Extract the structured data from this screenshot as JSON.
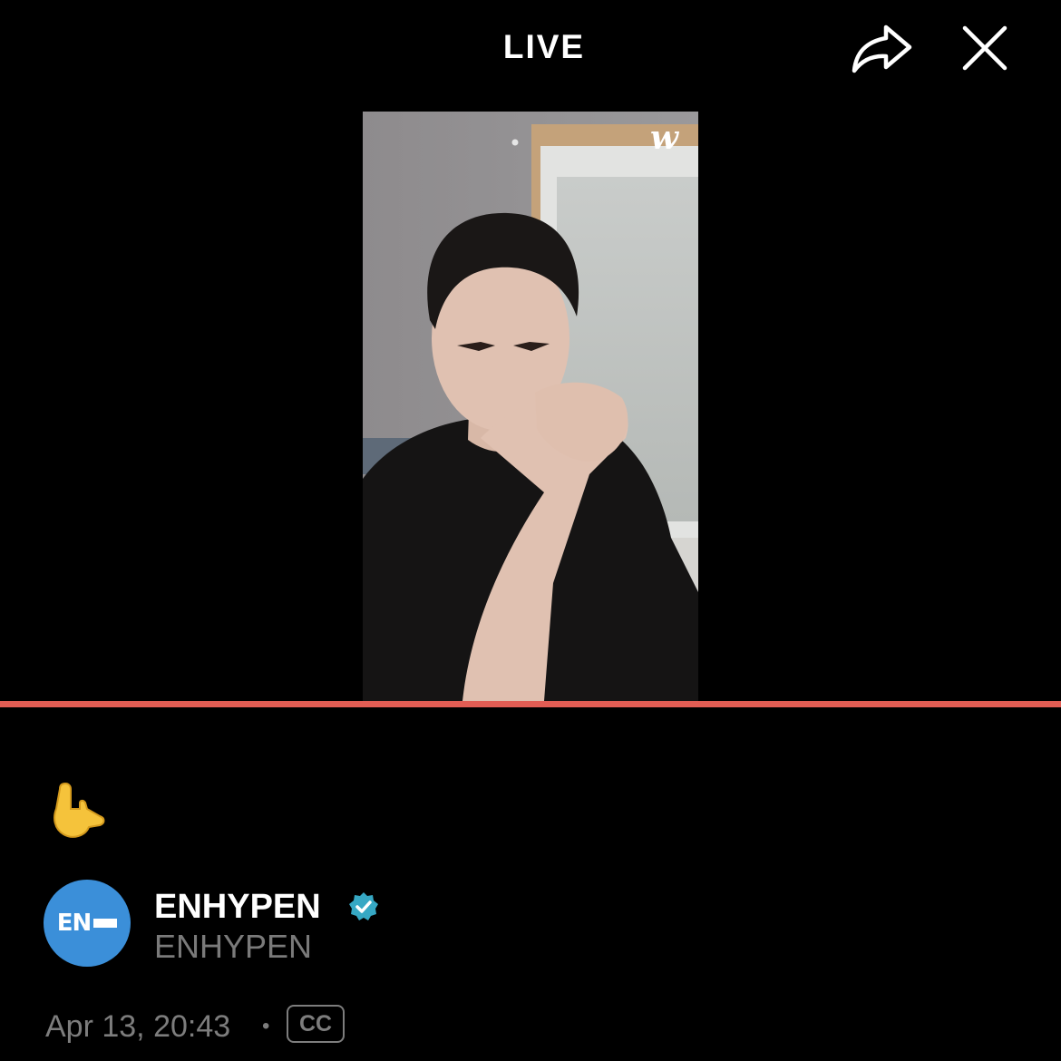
{
  "header": {
    "title": "LIVE",
    "icons": [
      "share-icon",
      "close-icon"
    ]
  },
  "video": {
    "watermark": "w",
    "progress_percent": 100,
    "accent_color": "#e25d54"
  },
  "post": {
    "emoji": "🤟"
  },
  "channel": {
    "name": "ENHYPEN",
    "handle": "ENHYPEN",
    "avatar_text": "EN",
    "avatar_color": "#3b8fd9",
    "verified_color": "#36a8c4"
  },
  "meta": {
    "date": "Apr 13, 20:43",
    "separator": "•",
    "cc_label": "CC"
  }
}
